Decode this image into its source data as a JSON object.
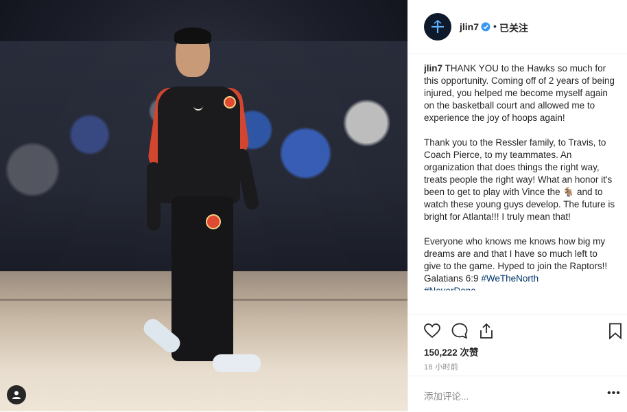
{
  "post": {
    "username": "jlin7",
    "follow_status": "已关注",
    "separator": "•",
    "caption": {
      "username": "jlin7",
      "p1": "THANK YOU to the Hawks so much for this opportunity. Coming off of 2 years of being injured, you helped me become myself again on the basketball court and allowed me to experience the joy of hoops again!",
      "p2": "Thank you to the Ressler family, to Travis, to Coach Pierce, to my teammates. An organization that does things the right way, treats people the right way! What an honor it's been to get to play with Vince the 🐐 and to watch these young guys develop. The future is bright for Atlanta!!! I truly mean that!",
      "p3_text": "Everyone who knows me knows how big my dreams are and that I have so much left to give to the game. Hyped to join the Raptors!! Galatians 6:9 ",
      "hashtag1": "#WeTheNorth",
      "hashtag2": "#NeverDone"
    },
    "likes": "150,222 次赞",
    "time": "18 小时前",
    "comment_placeholder": "添加评论...",
    "more": "•••"
  },
  "icons": {
    "like": "heart-icon",
    "comment": "comment-icon",
    "share": "share-icon",
    "save": "bookmark-icon",
    "verified": "verified-badge-icon",
    "tag_user": "user-tag-icon"
  },
  "colors": {
    "verified_blue": "#3897f0",
    "hashtag": "#003569",
    "muted": "#8e8e8e"
  }
}
